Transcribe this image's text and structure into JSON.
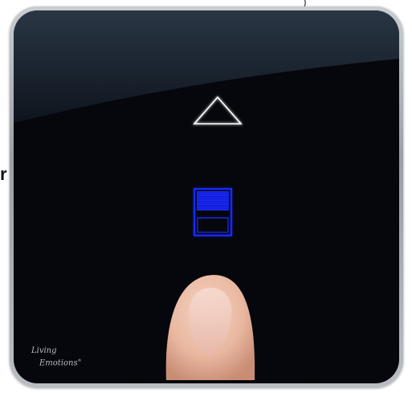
{
  "edge_letter": "r",
  "corner_mark": ")",
  "brand": {
    "line1": "Living",
    "line2": "Emotions",
    "reg_mark": "®"
  },
  "colors": {
    "glass": "#05070d",
    "frame": "#b0b5ba",
    "arrow_glow": "#ffffff",
    "shade_blue": "#1a2cff"
  },
  "icons": {
    "arrow": "up-triangle-icon",
    "shade": "roller-shade-icon"
  },
  "shade_level": 0.45
}
